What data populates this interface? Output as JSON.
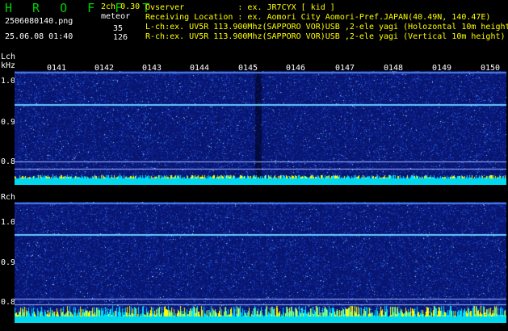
{
  "header": {
    "app_title": "H R O F F T",
    "version": "2ch 0.30",
    "filename": "2506080140.png",
    "meteor_label": "meteor",
    "count_lch": "35",
    "count_rch": "126",
    "datetime": "25.06.08 01:40"
  },
  "info": {
    "observer": "Ovserver           : ex. JR7CYX [ kid ]",
    "location": "Receiving Location : ex. Aomori City Aomori-Pref.JAPAN(40.49N, 140.47E)",
    "lch": "L-ch:ex. UV5R 113.900Mhz(SAPPORO VOR)USB ,2-ele yagi (Holozontal 10m height)",
    "rch": "R-ch:ex. UV5R 113.900Mhz(SAPPORO VOR)USB ,2-ele yagi (Vertical 10m height)"
  },
  "axes": {
    "lch_label": "Lch",
    "unit": "kHz",
    "rch_label": "Rch",
    "yticks": [
      "1.0",
      "0.9",
      "0.8"
    ],
    "time_ticks": [
      "0141",
      "0142",
      "0143",
      "0144",
      "0145",
      "0146",
      "0147",
      "0148",
      "0149",
      "0150"
    ]
  },
  "colors": {
    "background": "#000000",
    "title": "#00d000",
    "info_text": "#ffff00",
    "label_text": "#ffffff",
    "noise_base": "#0a1a8a",
    "signal_line": "#66ccff",
    "baseline_cyan": "#00e5ff",
    "meteor_spike": "#ffff00"
  }
}
